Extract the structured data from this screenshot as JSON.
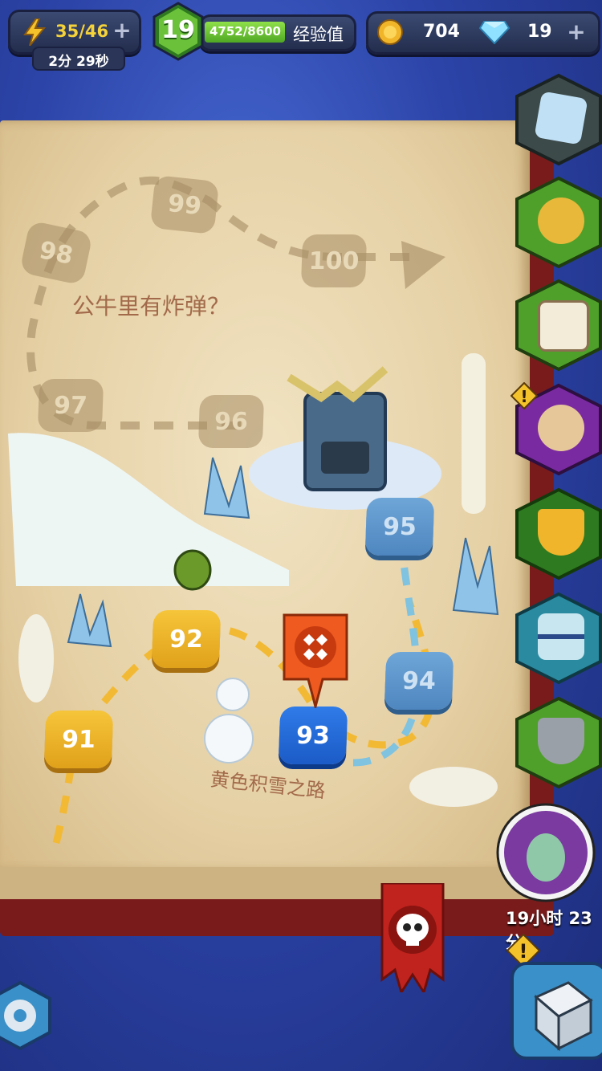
{
  "hud": {
    "energy": "35/46",
    "energy_timer": "2分 29秒",
    "level": "19",
    "xp": "4752/8600",
    "xp_fraction": 0.55,
    "xp_label": "经验值",
    "gold": "704",
    "gems": "19"
  },
  "map": {
    "title": "公牛里有炸弹？",
    "subtitle": "黄色积雪之路",
    "nodes": [
      {
        "label": "91",
        "state": "done"
      },
      {
        "label": "92",
        "state": "done"
      },
      {
        "label": "93",
        "state": "current"
      },
      {
        "label": "94",
        "state": "locked"
      },
      {
        "label": "95",
        "state": "locked"
      },
      {
        "label": "96",
        "state": "faded"
      },
      {
        "label": "97",
        "state": "faded"
      },
      {
        "label": "98",
        "state": "faded"
      },
      {
        "label": "99",
        "state": "faded"
      },
      {
        "label": "100",
        "state": "faded"
      }
    ]
  },
  "side_menu": [
    {
      "name": "ice-cube-icon",
      "color": "#3d4a4a"
    },
    {
      "name": "horn-icon",
      "color": "#4fa02a"
    },
    {
      "name": "calendar-icon",
      "color": "#4fa02a"
    },
    {
      "name": "hero-event-icon",
      "color": "#7a2aa0"
    },
    {
      "name": "trophy-icon",
      "color": "#2e7a20"
    },
    {
      "name": "hourglass-icon",
      "color": "#2a8aa0"
    },
    {
      "name": "shield-swords-icon",
      "color": "#4fa02a"
    }
  ],
  "hero_timer": "19小时 23分",
  "colors": {
    "done": "#f0b52a",
    "current": "#2269d8",
    "locked": "#5f97cc"
  }
}
